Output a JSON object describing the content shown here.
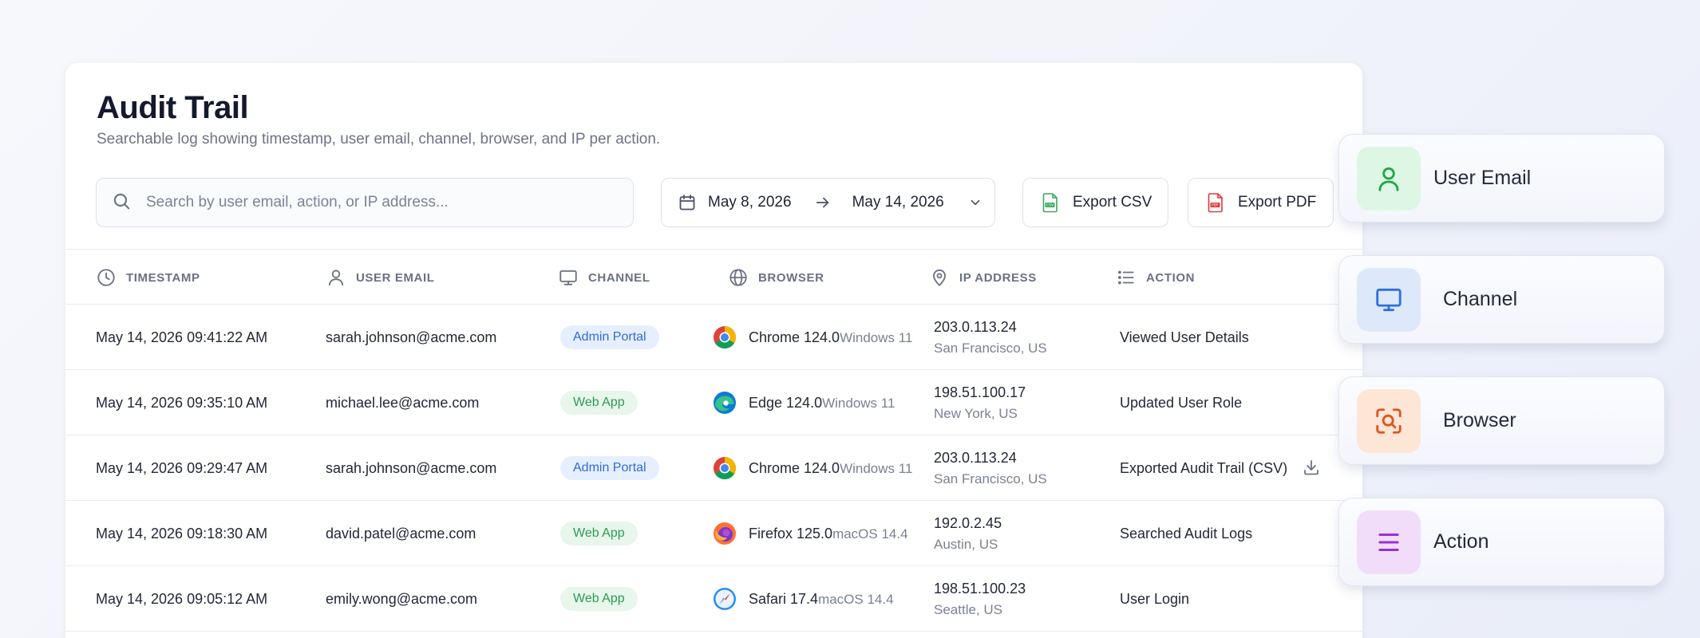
{
  "header": {
    "title": "Audit Trail",
    "subtitle": "Searchable log showing timestamp, user email, channel, browser, and IP per action."
  },
  "search": {
    "placeholder": "Search by user email, action, or IP address...",
    "icon": "search-icon"
  },
  "date_range": {
    "start": "May 8, 2026",
    "end": "May 14, 2026"
  },
  "toolbar": {
    "export_csv_label": "Export CSV",
    "export_pdf_label": "Export PDF"
  },
  "columns": {
    "timestamp": "TIMESTAMP",
    "user_email": "USER EMAIL",
    "channel": "CHANNEL",
    "browser": "BROWSER",
    "ip_address": "IP ADDRESS",
    "action": "ACTION"
  },
  "rows": [
    {
      "timestamp": "May 14, 2026 09:41:22 AM",
      "email": "sarah.johnson@acme.com",
      "channel": "Admin Portal",
      "channel_type": "admin",
      "browser": "Chrome 124.0",
      "browser_icon": "chrome-icon",
      "os": "Windows 11",
      "ip": "203.0.113.24",
      "location": "San Francisco, US",
      "action": "Viewed User Details"
    },
    {
      "timestamp": "May 14, 2026 09:35:10 AM",
      "email": "michael.lee@acme.com",
      "channel": "Web App",
      "channel_type": "web",
      "browser": "Edge 124.0",
      "browser_icon": "edge-icon",
      "os": "Windows 11",
      "ip": "198.51.100.17",
      "location": "New York, US",
      "action": "Updated User Role"
    },
    {
      "timestamp": "May 14, 2026 09:29:47 AM",
      "email": "sarah.johnson@acme.com",
      "channel": "Admin Portal",
      "channel_type": "admin",
      "browser": "Chrome 124.0",
      "browser_icon": "chrome-icon",
      "os": "Windows 11",
      "ip": "203.0.113.24",
      "location": "San Francisco, US",
      "action": "Exported Audit Trail (CSV)"
    },
    {
      "timestamp": "May 14, 2026 09:18:30 AM",
      "email": "david.patel@acme.com",
      "channel": "Web App",
      "channel_type": "web",
      "browser": "Firefox 125.0",
      "browser_icon": "firefox-icon",
      "os": "macOS 14.4",
      "ip": "192.0.2.45",
      "location": "Austin, US",
      "action": "Searched Audit Logs"
    },
    {
      "timestamp": "May 14, 2026 09:05:12 AM",
      "email": "emily.wong@acme.com",
      "channel": "Web App",
      "channel_type": "web",
      "browser": "Safari 17.4",
      "browser_icon": "safari-icon",
      "os": "macOS 14.4",
      "ip": "198.51.100.23",
      "location": "Seattle, US",
      "action": "User Login"
    }
  ],
  "feature_cards": [
    {
      "label": "User Email",
      "icon": "user-icon",
      "color": "#22a84a",
      "tile_bg": "#def7e4"
    },
    {
      "label": "Channel",
      "icon": "monitor-icon",
      "color": "#2e6fe0",
      "tile_bg": "#dde8fb"
    },
    {
      "label": "Browser",
      "icon": "browser-search-icon",
      "color": "#e0541f",
      "tile_bg": "#fde6d6"
    },
    {
      "label": "Action",
      "icon": "list-icon",
      "color": "#9a2fd6",
      "tile_bg": "#f1ddf9"
    }
  ],
  "colors": {
    "admin_badge_bg": "#e6efff",
    "admin_badge_text": "#2f6bdc",
    "web_badge_bg": "#e8f6ec",
    "web_badge_text": "#2f9a54",
    "csv_icon": "#3aa75a",
    "pdf_icon": "#e03a3a"
  }
}
